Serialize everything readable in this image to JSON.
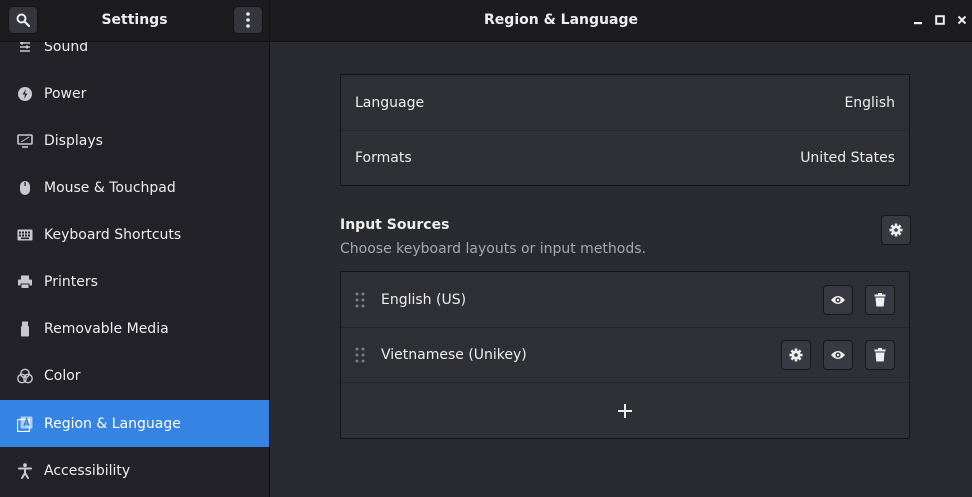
{
  "header": {
    "sidebar_title": "Settings",
    "page_title": "Region & Language"
  },
  "sidebar": {
    "items": [
      {
        "label": "Sound",
        "icon": "speaker-icon"
      },
      {
        "label": "Power",
        "icon": "power-icon"
      },
      {
        "label": "Displays",
        "icon": "display-icon"
      },
      {
        "label": "Mouse & Touchpad",
        "icon": "mouse-icon"
      },
      {
        "label": "Keyboard Shortcuts",
        "icon": "keyboard-icon"
      },
      {
        "label": "Printers",
        "icon": "printer-icon"
      },
      {
        "label": "Removable Media",
        "icon": "usb-drive-icon"
      },
      {
        "label": "Color",
        "icon": "color-icon"
      },
      {
        "label": "Region & Language",
        "icon": "region-language-icon",
        "active": true
      },
      {
        "label": "Accessibility",
        "icon": "accessibility-icon"
      }
    ]
  },
  "language": {
    "label": "Language",
    "value": "English"
  },
  "formats": {
    "label": "Formats",
    "value": "United States"
  },
  "input_sources": {
    "title": "Input Sources",
    "subtitle": "Choose keyboard layouts or input methods.",
    "sources": [
      {
        "name": "English (US)"
      },
      {
        "name": "Vietnamese (Unikey)"
      }
    ]
  },
  "colors": {
    "accent": "#3584e4",
    "background": "#2a2a31",
    "sidebar": "#222228",
    "headerbar": "#1b1b20"
  }
}
